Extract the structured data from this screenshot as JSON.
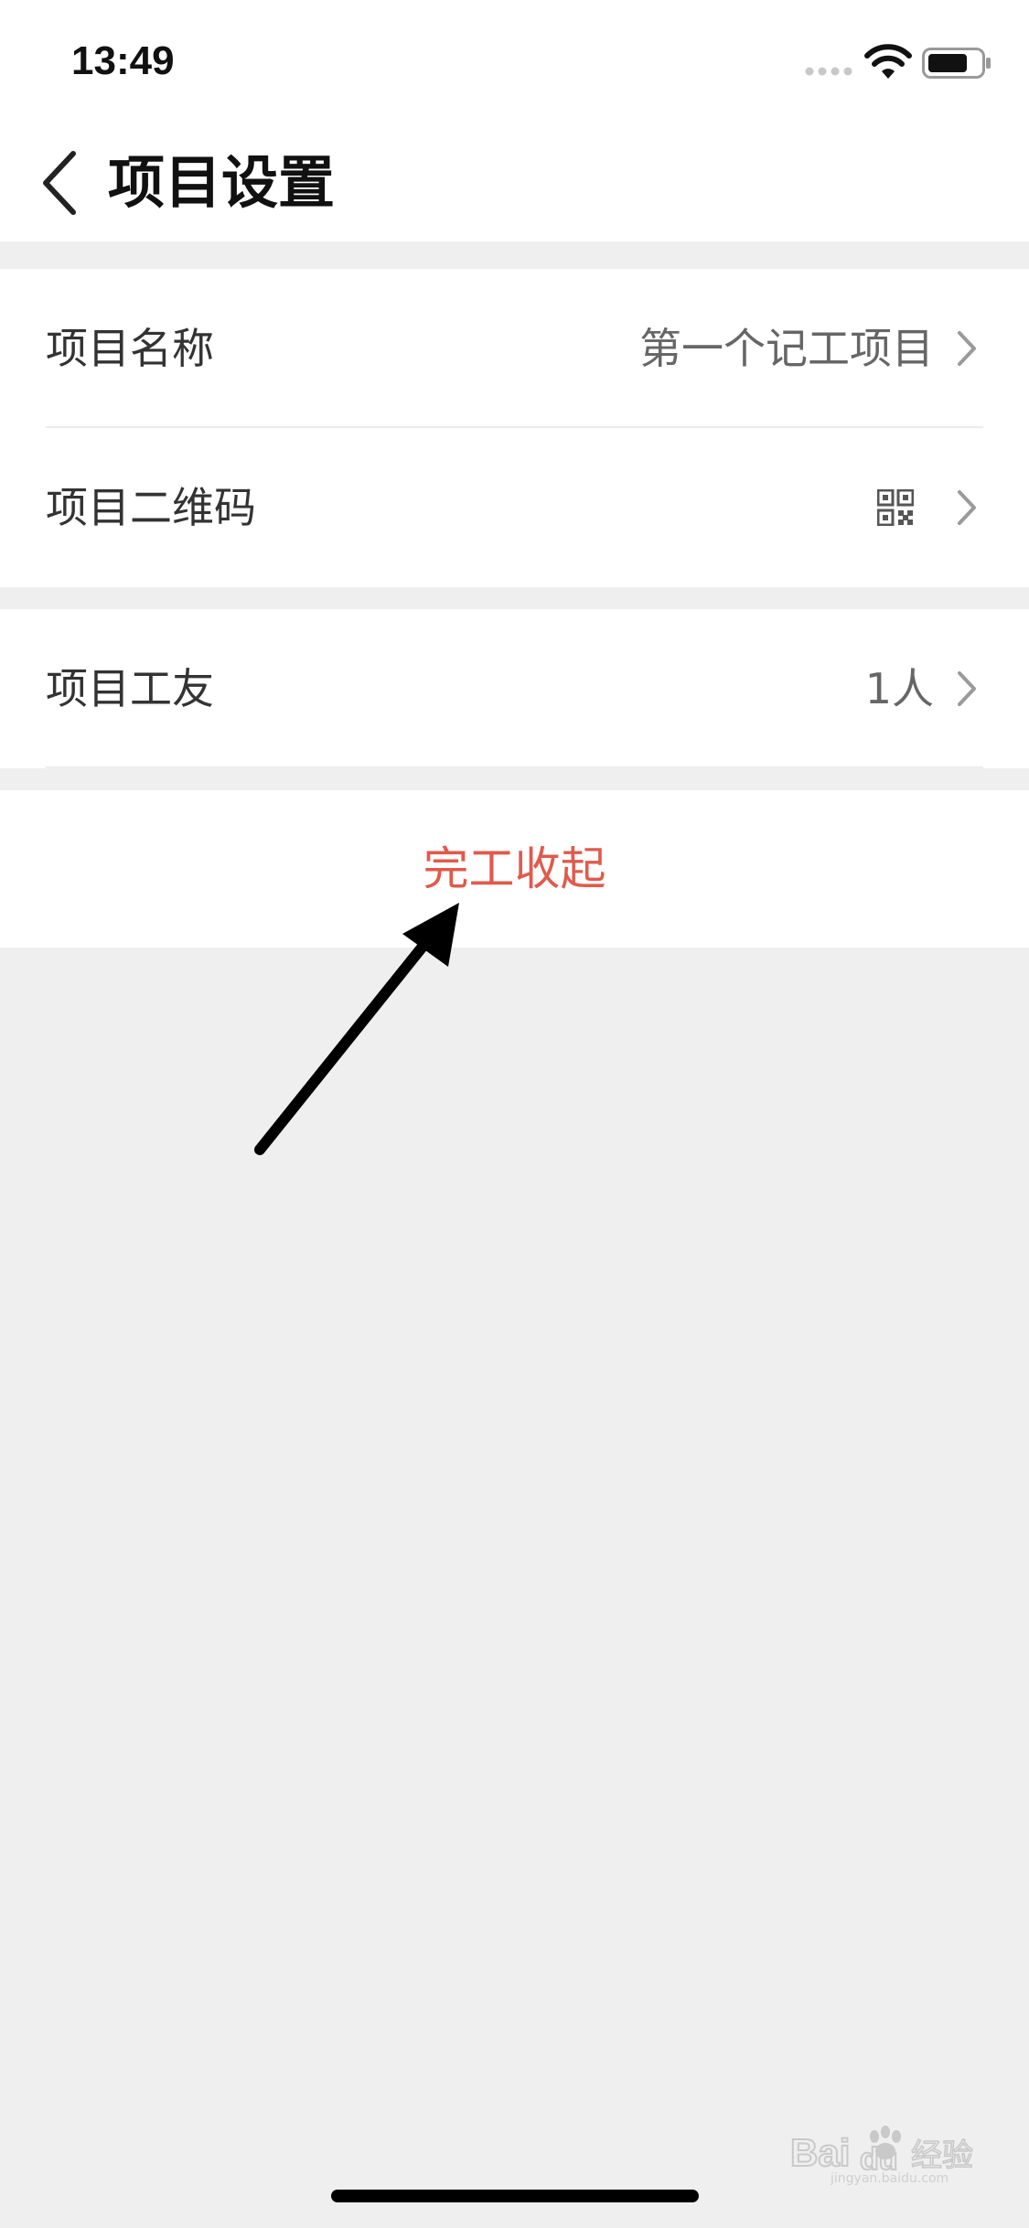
{
  "status_bar": {
    "time": "13:49"
  },
  "nav": {
    "title": "项目设置"
  },
  "settings": {
    "project_name": {
      "label": "项目名称",
      "value": "第一个记工项目"
    },
    "project_qrcode": {
      "label": "项目二维码"
    },
    "project_workers": {
      "label": "项目工友",
      "value": "1人"
    }
  },
  "actions": {
    "finish_label": "完工收起"
  },
  "colors": {
    "danger": "#e05a4c",
    "background": "#efefef",
    "annotation_arrow": "#000000"
  },
  "watermark": {
    "text": "Bai du 经验",
    "subtext": "jingyan.baidu.com"
  }
}
